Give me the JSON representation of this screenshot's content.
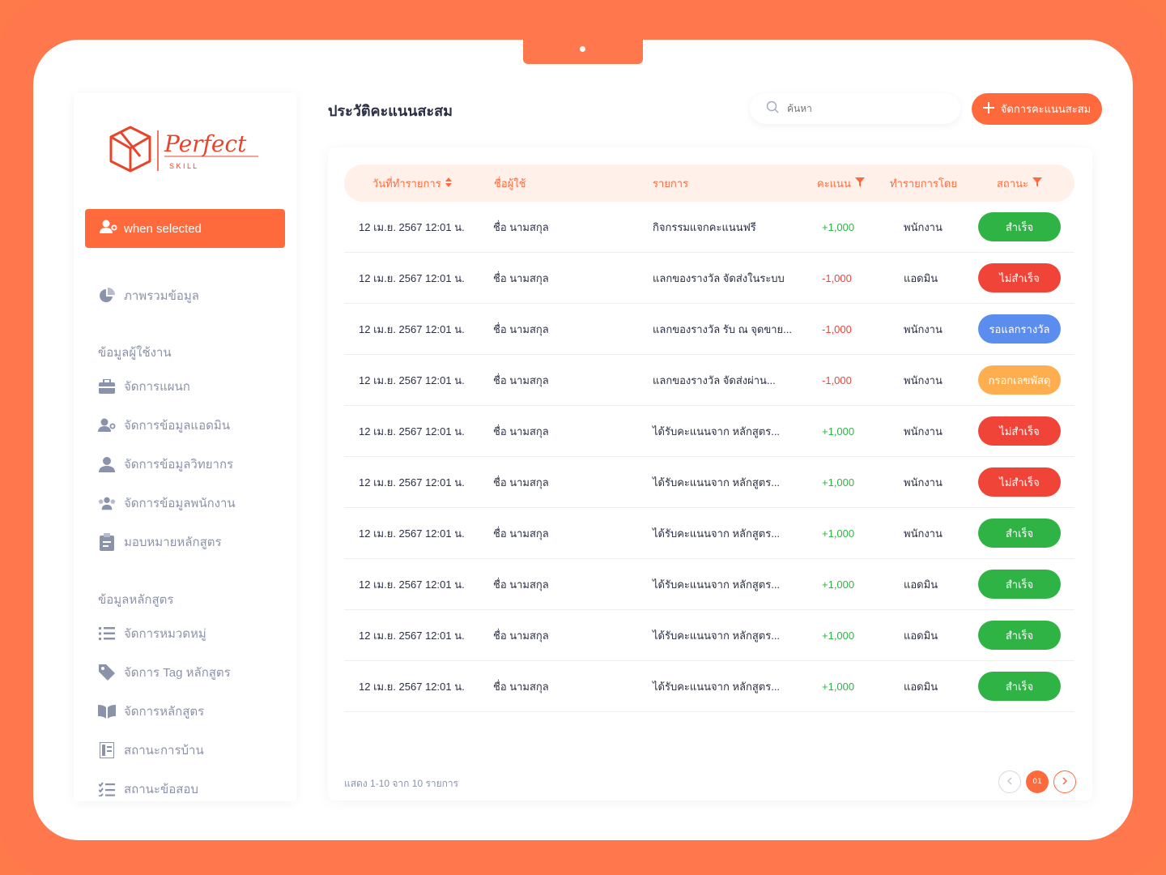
{
  "brand": {
    "name": "Perfect",
    "tagline": "S K I L L"
  },
  "colors": {
    "accent": "#ff6a3d",
    "success": "#2fb344",
    "fail": "#f04438",
    "pending": "#5b8def",
    "warning": "#ffae4f"
  },
  "sidebar": {
    "active_item": {
      "label": "when selected",
      "icon": "user-gear-icon"
    },
    "overview": {
      "label": "ภาพรวมข้อมูล",
      "icon": "pie-chart-icon"
    },
    "sections": [
      {
        "label": "ข้อมูลผู้ใช้งาน",
        "items": [
          {
            "label": "จัดการแผนก",
            "icon": "briefcase-icon"
          },
          {
            "label": "จัดการข้อมูลแอดมิน",
            "icon": "user-gear-icon"
          },
          {
            "label": "จัดการข้อมูลวิทยากร",
            "icon": "user-icon"
          },
          {
            "label": "จัดการข้อมูลพนักงาน",
            "icon": "users-icon"
          },
          {
            "label": "มอบหมายหลักสูตร",
            "icon": "clipboard-icon"
          }
        ]
      },
      {
        "label": "ข้อมูลหลักสูตร",
        "items": [
          {
            "label": "จัดการหมวดหมู่",
            "icon": "list-icon"
          },
          {
            "label": "จัดการ Tag หลักสูตร",
            "icon": "tag-icon"
          },
          {
            "label": "จัดการหลักสูตร",
            "icon": "book-icon"
          },
          {
            "label": "สถานะการบ้าน",
            "icon": "notebook-icon"
          },
          {
            "label": "สถานะข้อสอบ",
            "icon": "checklist-icon"
          }
        ]
      }
    ]
  },
  "header": {
    "title": "ประวัติคะแนนสะสม",
    "search_placeholder": "ค้นหา",
    "add_button": "จัดการคะแนนสะสม"
  },
  "table": {
    "columns": [
      "วันที่ทำรายการ",
      "ชื่อผู้ใช้",
      "รายการ",
      "คะแนน",
      "ทำรายการโดย",
      "สถานะ"
    ],
    "rows": [
      {
        "date": "12 เม.ย. 2567 12:01 น.",
        "user": "ชื่อ นามสกุล",
        "item": "กิจกรรมแจกคะแนนฟรี",
        "points": "+1,000",
        "by": "พนักงาน",
        "status": "สำเร็จ",
        "status_type": "success"
      },
      {
        "date": "12 เม.ย. 2567 12:01 น.",
        "user": "ชื่อ นามสกุล",
        "item": "แลกของรางวัล จัดส่งในระบบ",
        "points": "-1,000",
        "by": "แอดมิน",
        "status": "ไม่สำเร็จ",
        "status_type": "fail"
      },
      {
        "date": "12 เม.ย. 2567 12:01 น.",
        "user": "ชื่อ นามสกุล",
        "item": "แลกของรางวัล รับ ณ จุดขาย...",
        "points": "-1,000",
        "by": "พนักงาน",
        "status": "รอแลกรางวัล",
        "status_type": "pending"
      },
      {
        "date": "12 เม.ย. 2567 12:01 น.",
        "user": "ชื่อ นามสกุล",
        "item": "แลกของรางวัล จัดส่งผ่าน...",
        "points": "-1,000",
        "by": "พนักงาน",
        "status": "กรอกเลขพัสดุ",
        "status_type": "warning"
      },
      {
        "date": "12 เม.ย. 2567 12:01 น.",
        "user": "ชื่อ นามสกุล",
        "item": "ได้รับคะแนนจาก หลักสูตร...",
        "points": "+1,000",
        "by": "พนักงาน",
        "status": "ไม่สำเร็จ",
        "status_type": "fail"
      },
      {
        "date": "12 เม.ย. 2567 12:01 น.",
        "user": "ชื่อ นามสกุล",
        "item": "ได้รับคะแนนจาก หลักสูตร...",
        "points": "+1,000",
        "by": "พนักงาน",
        "status": "ไม่สำเร็จ",
        "status_type": "fail"
      },
      {
        "date": "12 เม.ย. 2567 12:01 น.",
        "user": "ชื่อ นามสกุล",
        "item": "ได้รับคะแนนจาก หลักสูตร...",
        "points": "+1,000",
        "by": "พนักงาน",
        "status": "สำเร็จ",
        "status_type": "success"
      },
      {
        "date": "12 เม.ย. 2567 12:01 น.",
        "user": "ชื่อ นามสกุล",
        "item": "ได้รับคะแนนจาก หลักสูตร...",
        "points": "+1,000",
        "by": "แอดมิน",
        "status": "สำเร็จ",
        "status_type": "success"
      },
      {
        "date": "12 เม.ย. 2567 12:01 น.",
        "user": "ชื่อ นามสกุล",
        "item": "ได้รับคะแนนจาก หลักสูตร...",
        "points": "+1,000",
        "by": "แอดมิน",
        "status": "สำเร็จ",
        "status_type": "success"
      },
      {
        "date": "12 เม.ย. 2567 12:01 น.",
        "user": "ชื่อ นามสกุล",
        "item": "ได้รับคะแนนจาก หลักสูตร...",
        "points": "+1,000",
        "by": "แอดมิน",
        "status": "สำเร็จ",
        "status_type": "success"
      }
    ]
  },
  "footer": {
    "summary": "แสดง 1-10 จาก 10 รายการ",
    "current_page": "01"
  }
}
